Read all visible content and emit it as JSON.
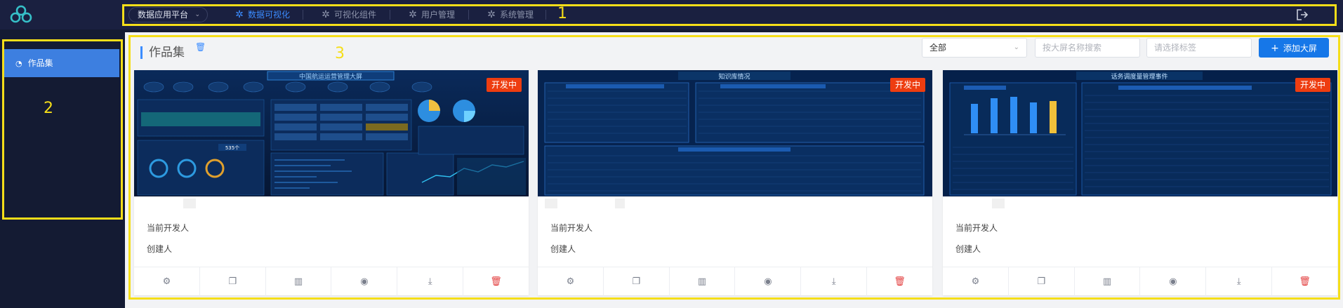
{
  "topbar": {
    "platform_label": "数据应用平台",
    "nav": [
      {
        "label": "数据可视化",
        "icon": "gear-icon",
        "active": true
      },
      {
        "label": "可视化组件",
        "icon": "gear-icon",
        "active": false
      },
      {
        "label": "用户管理",
        "icon": "gear-icon",
        "active": false
      },
      {
        "label": "系统管理",
        "icon": "gear-icon",
        "active": false
      }
    ],
    "logout_icon": "logout-icon",
    "accent_color": "#3b8cff"
  },
  "annotations": {
    "box1": "1",
    "box2": "2",
    "box3": "3",
    "color": "#f5de19"
  },
  "sidebar": {
    "items": [
      {
        "label": "作品集",
        "icon": "clock-icon",
        "active": true
      }
    ]
  },
  "main": {
    "title": "作品集",
    "filter": {
      "value": "全部"
    },
    "search": {
      "placeholder": "按大屏名称搜索"
    },
    "tag": {
      "placeholder": "请选择标签"
    },
    "add_button_label": "添加大屏",
    "cards": [
      {
        "badge": "开发中",
        "name": "",
        "developer_label": "当前开发人",
        "creator_label": "创建人",
        "actions": [
          "settings-icon",
          "copy-icon",
          "chart-icon",
          "eye-icon",
          "download-icon",
          "delete-icon"
        ]
      },
      {
        "badge": "开发中",
        "name": "",
        "developer_label": "当前开发人",
        "creator_label": "创建人",
        "actions": [
          "settings-icon",
          "copy-icon",
          "chart-icon",
          "eye-icon",
          "download-icon",
          "delete-icon"
        ]
      },
      {
        "badge": "开发中",
        "name": "",
        "developer_label": "当前开发人",
        "creator_label": "创建人",
        "actions": [
          "settings-icon",
          "copy-icon",
          "chart-icon",
          "eye-icon",
          "download-icon",
          "delete-icon"
        ]
      }
    ],
    "thumbnails": [
      {
        "title": "中国航运运营管理大屏",
        "stat": "535个"
      },
      {
        "title": "知识库情况"
      },
      {
        "title": "话务调度量管理事件"
      }
    ]
  }
}
